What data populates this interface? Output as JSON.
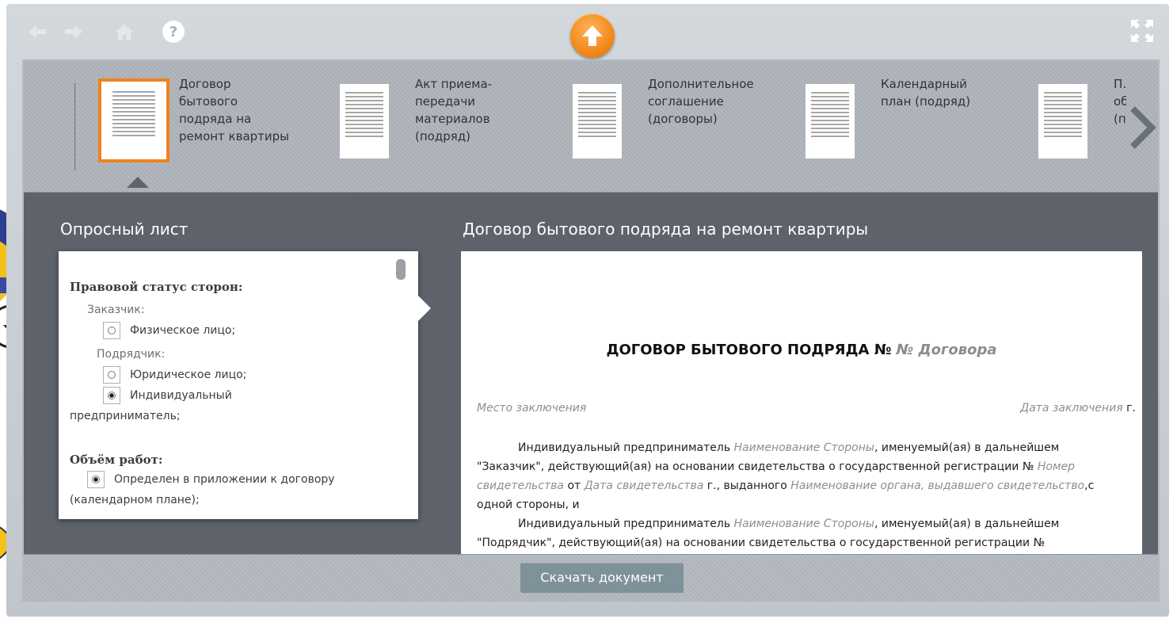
{
  "toolbar": {
    "icons": [
      "arrow-left-icon",
      "arrow-right-icon",
      "home-icon",
      "help-icon",
      "upload-icon",
      "fullscreen-icon"
    ]
  },
  "documents": [
    {
      "label": "Договор бытового подряда на ремонт квартиры",
      "active": true
    },
    {
      "label": "Акт приема-передачи материалов (подряд)",
      "active": false
    },
    {
      "label": "Дополнительное соглашение (договоры)",
      "active": false
    },
    {
      "label": "Календарный план (подряд)",
      "active": false
    },
    {
      "label": "П… об… (п…",
      "active": false
    }
  ],
  "survey": {
    "title": "Опросный лист",
    "q1_title": "Правовой статус сторон:",
    "customer_label": "Заказчик:",
    "opt_individual": "Физическое лицо;",
    "contractor_label": "Подрядчик:",
    "opt_legal": "Юридическое лицо;",
    "opt_entrepreneur_line1": "Индивидуальный",
    "opt_entrepreneur_line2": "предприниматель;",
    "q2_title": "Объём работ:",
    "opt_volume_line1": "Определен в приложении к договору",
    "opt_volume_line2": "(календарном плане);",
    "selected": {
      "customer": "Физическое лицо;",
      "contractor": "Индивидуальный предприниматель;",
      "volume": "Определен в приложении к договору (календарном плане);"
    }
  },
  "preview": {
    "title": "Договор бытового подряда на ремонт квартиры",
    "heading_static": "ДОГОВОР БЫТОВОГО ПОДРЯДА № ",
    "heading_ph": "№ Договора",
    "place_ph": "Место заключения",
    "date_ph": "Дата заключения",
    "date_suffix": " г.",
    "p1_a": "Индивидуальный предприниматель ",
    "p1_ph1": "Наименование Стороны",
    "p1_b": ", именуемый(ая) в дальнейшем \"Заказчик\", действующий(ая) на основании свидетельства о государственной регистрации № ",
    "p1_ph2": "Номер свидетельства",
    "p1_c": " от ",
    "p1_ph3": "Дата свидетельства",
    "p1_d": " г., выданного ",
    "p1_ph4": "Наименование органа, выдавшего свидетельство",
    "p1_e": ",с одной стороны, и",
    "p2_a": "Индивидуальный предприниматель ",
    "p2_ph1": "Наименование Стороны",
    "p2_b": ", именуемый(ая) в дальнейшем \"Подрядчик\", действующий(ая) на основании свидетельства о государственной регистрации №"
  },
  "download_label": "Скачать документ",
  "colors": {
    "accent": "#f0821d",
    "panel_bg": "#5d626b",
    "download_bg": "#7f9199"
  }
}
